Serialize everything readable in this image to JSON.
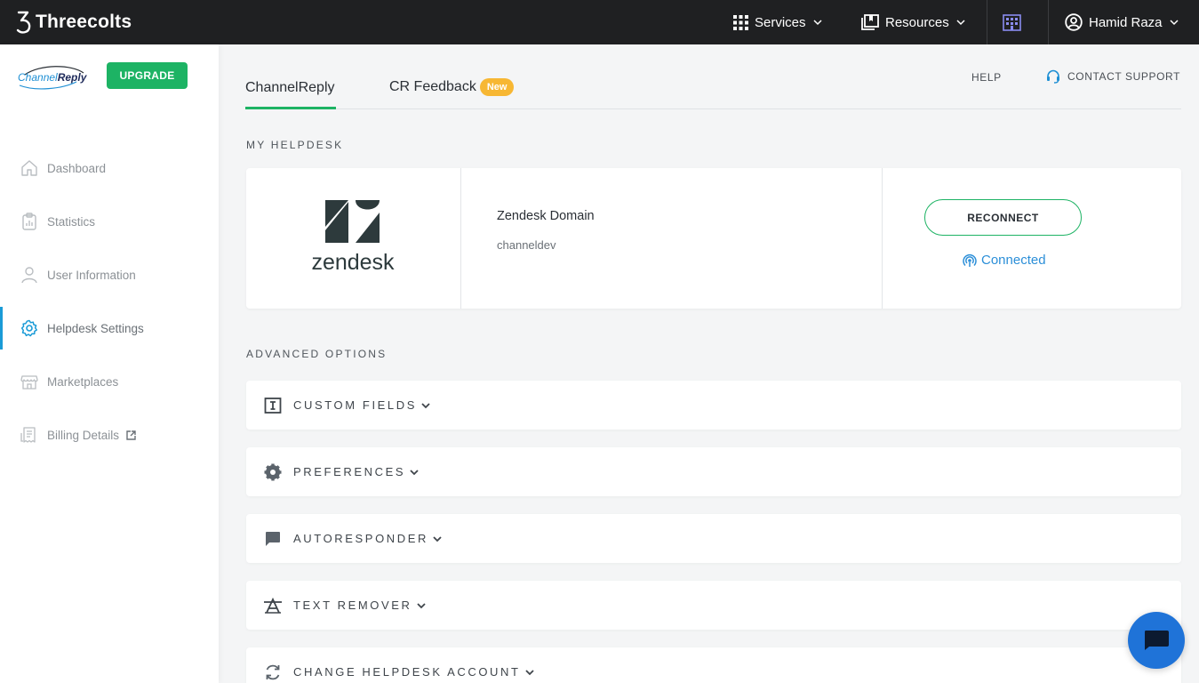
{
  "topbar": {
    "brand": "Threecolts",
    "services": "Services",
    "resources": "Resources",
    "user": "Hamid Raza"
  },
  "sidebar": {
    "logo_text": "ChannelReply",
    "upgrade": "UPGRADE",
    "items": [
      {
        "label": "Dashboard",
        "icon": "home-icon"
      },
      {
        "label": "Statistics",
        "icon": "clipboard-chart-icon"
      },
      {
        "label": "User Information",
        "icon": "user-icon"
      },
      {
        "label": "Helpdesk Settings",
        "icon": "gear-icon",
        "active": true
      },
      {
        "label": "Marketplaces",
        "icon": "store-icon"
      },
      {
        "label": "Billing Details",
        "icon": "receipt-icon",
        "external": true
      }
    ]
  },
  "main": {
    "tabs": [
      {
        "label": "ChannelReply",
        "active": true
      },
      {
        "label": "CR Feedback",
        "badge": "New"
      }
    ],
    "help": "HELP",
    "contact_support": "CONTACT SUPPORT",
    "my_helpdesk_title": "MY HELPDESK",
    "helpdesk": {
      "logo_text": "zendesk",
      "domain_label": "Zendesk Domain",
      "domain_value": "channeldev",
      "reconnect": "RECONNECT",
      "status": "Connected"
    },
    "advanced_title": "ADVANCED OPTIONS",
    "options": [
      {
        "label": "CUSTOM FIELDS",
        "icon": "text-field-icon"
      },
      {
        "label": "PREFERENCES",
        "icon": "gear-icon"
      },
      {
        "label": "AUTORESPONDER",
        "icon": "chat-bubble-icon"
      },
      {
        "label": "TEXT REMOVER",
        "icon": "strikethrough-icon"
      },
      {
        "label": "CHANGE HELPDESK ACCOUNT",
        "icon": "refresh-icon"
      }
    ]
  },
  "colors": {
    "topbar": "#1f2022",
    "accent_green": "#1db364",
    "active_blue": "#1a9bd7",
    "connected_blue": "#2c8fd8",
    "badge_orange": "#f7b733",
    "chat_fab": "#1f73d8"
  }
}
